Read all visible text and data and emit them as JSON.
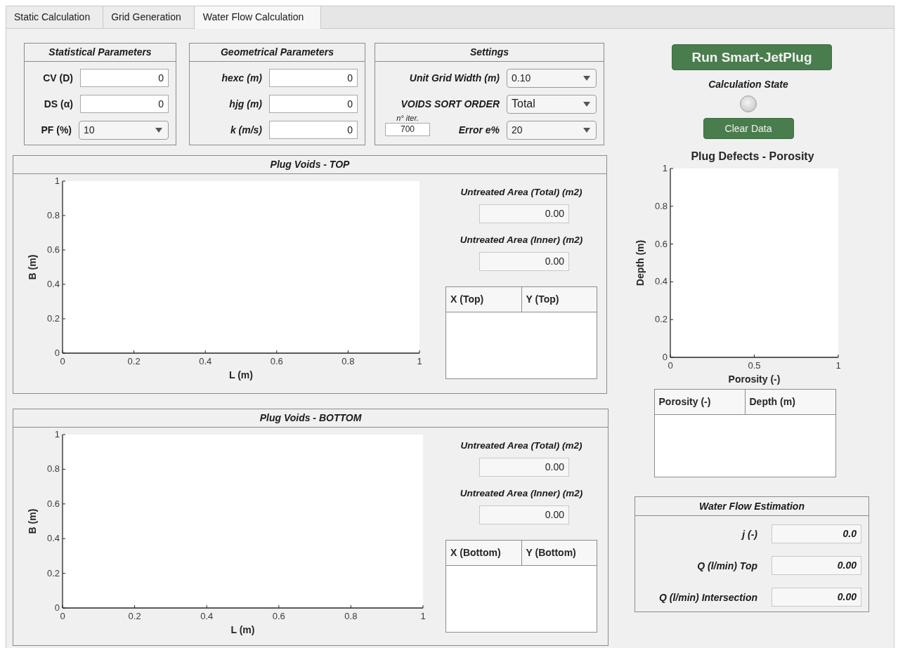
{
  "tabs": [
    {
      "label": "Static Calculation",
      "selected": false
    },
    {
      "label": "Grid Generation",
      "selected": false
    },
    {
      "label": "Water Flow Calculation",
      "selected": true
    }
  ],
  "statistical_parameters": {
    "title": "Statistical Parameters",
    "fields": [
      {
        "label": "CV (D)",
        "kind": "input",
        "value": "0"
      },
      {
        "label": "DS (α)",
        "kind": "input",
        "value": "0"
      },
      {
        "label": "PF (%)",
        "kind": "dropdown",
        "value": "10"
      }
    ]
  },
  "geometrical_parameters": {
    "title": "Geometrical Parameters",
    "fields": [
      {
        "label": "hexc (m)",
        "kind": "input",
        "value": "0"
      },
      {
        "label": "hjg (m)",
        "kind": "input",
        "value": "0"
      },
      {
        "label": "k (m/s)",
        "kind": "input",
        "value": "0"
      }
    ]
  },
  "settings": {
    "title": "Settings",
    "fields": [
      {
        "label": "Unit Grid Width (m)",
        "kind": "dropdown",
        "value": "0.10"
      },
      {
        "label": "VOIDS SORT ORDER",
        "kind": "dropdown",
        "value": "Total"
      },
      {
        "label": "Error e%",
        "kind": "dropdown",
        "value": "20",
        "iterations": {
          "label": "n° iter.",
          "value": "700"
        }
      }
    ]
  },
  "run_button": "Run Smart-JetPlug",
  "calculation_state": {
    "label": "Calculation State",
    "on": false
  },
  "clear_button": "Clear Data",
  "void_panels": [
    {
      "title": "Plug Voids - TOP",
      "chart_data": {
        "type": "scatter",
        "xlabel": "L  (m)",
        "ylabel": "B  (m)",
        "xlim": [
          0,
          1
        ],
        "ylim": [
          0,
          1
        ],
        "xticks": [
          0,
          0.2,
          0.4,
          0.6,
          0.8,
          1
        ],
        "yticks": [
          0,
          0.2,
          0.4,
          0.6,
          0.8,
          1
        ]
      },
      "areas": [
        {
          "label": "Untreated Area (Total) (m2)",
          "value": "0.00"
        },
        {
          "label": "Untreated Area (Inner) (m2)",
          "value": "0.00"
        }
      ],
      "table": {
        "columns": [
          "X (Top)",
          "Y (Top)"
        ]
      }
    },
    {
      "title": "Plug Voids - BOTTOM",
      "chart_data": {
        "type": "scatter",
        "xlabel": "L  (m)",
        "ylabel": "B  (m)",
        "xlim": [
          0,
          1
        ],
        "ylim": [
          0,
          1
        ],
        "xticks": [
          0,
          0.2,
          0.4,
          0.6,
          0.8,
          1
        ],
        "yticks": [
          0,
          0.2,
          0.4,
          0.6,
          0.8,
          1
        ]
      },
      "areas": [
        {
          "label": "Untreated Area (Total) (m2)",
          "value": "0.00"
        },
        {
          "label": "Untreated Area (Inner) (m2)",
          "value": "0.00"
        }
      ],
      "table": {
        "columns": [
          "X (Bottom)",
          "Y (Bottom)"
        ]
      }
    }
  ],
  "porosity": {
    "chart_data": {
      "type": "scatter",
      "title": "Plug Defects - Porosity",
      "xlabel": "Porosity  (-)",
      "ylabel": "Depth  (m)",
      "xlim": [
        0,
        1
      ],
      "ylim": [
        0,
        1
      ],
      "xticks": [
        0,
        0.5,
        1
      ],
      "yticks": [
        0,
        0.2,
        0.4,
        0.6,
        0.8,
        1
      ]
    },
    "table": {
      "columns": [
        "Porosity (-)",
        "Depth (m)"
      ]
    }
  },
  "water_flow": {
    "title": "Water Flow Estimation",
    "fields": [
      {
        "label": "j (-)",
        "value": "0.0"
      },
      {
        "label": "Q (l/min) Top",
        "value": "0.00"
      },
      {
        "label": "Q (l/min) Intersection",
        "value": "0.00"
      }
    ]
  }
}
